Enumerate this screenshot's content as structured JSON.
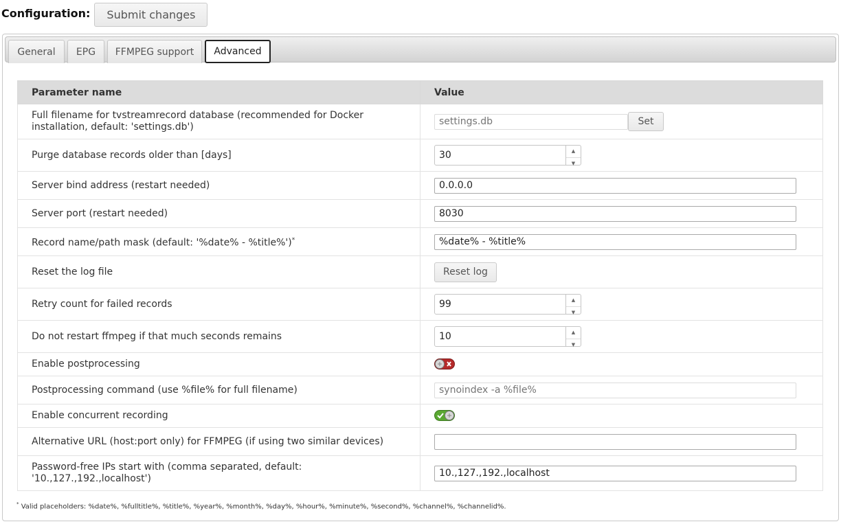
{
  "header": {
    "title": "Configuration:",
    "submit_label": "Submit changes"
  },
  "tabs": [
    "General",
    "EPG",
    "FFMPEG support",
    "Advanced"
  ],
  "active_tab": "Advanced",
  "table": {
    "col_param": "Parameter name",
    "col_value": "Value",
    "rows": [
      {
        "label": "Full filename for tvstreamrecord database (recommended for Docker installation, default: 'settings.db')",
        "placeholder": "settings.db",
        "button": "Set"
      },
      {
        "label": "Purge database records older than [days]",
        "value": "30"
      },
      {
        "label": "Server bind address (restart needed)",
        "value": "0.0.0.0"
      },
      {
        "label": "Server port (restart needed)",
        "value": "8030"
      },
      {
        "label": "Record name/path mask (default: '%date% - %title%')",
        "mark": "*",
        "value": "%date% - %title%"
      },
      {
        "label": "Reset the log file",
        "button": "Reset log"
      },
      {
        "label": "Retry count for failed records",
        "value": "99"
      },
      {
        "label": "Do not restart ffmpeg if that much seconds remains",
        "value": "10"
      },
      {
        "label": "Enable postprocessing",
        "toggle": false
      },
      {
        "label": "Postprocessing command (use %file% for full filename)",
        "placeholder": "synoindex -a %file%"
      },
      {
        "label": "Enable concurrent recording",
        "toggle": true
      },
      {
        "label": "Alternative URL (host:port only) for FFMPEG (if using two similar devices)",
        "value": ""
      },
      {
        "label": "Password-free IPs start with (comma separated, default: '10.,127.,192.,localhost')",
        "value": "10.,127.,192.,localhost"
      }
    ]
  },
  "footnote": {
    "mark": "*",
    "text": "Valid placeholders: %date%, %fulltitle%, %title%, %year%, %month%, %day%, %hour%, %minute%, %second%, %channel%, %channelid%."
  },
  "colors": {
    "toggle_off": "#b52a2a",
    "toggle_on": "#5aa832"
  }
}
